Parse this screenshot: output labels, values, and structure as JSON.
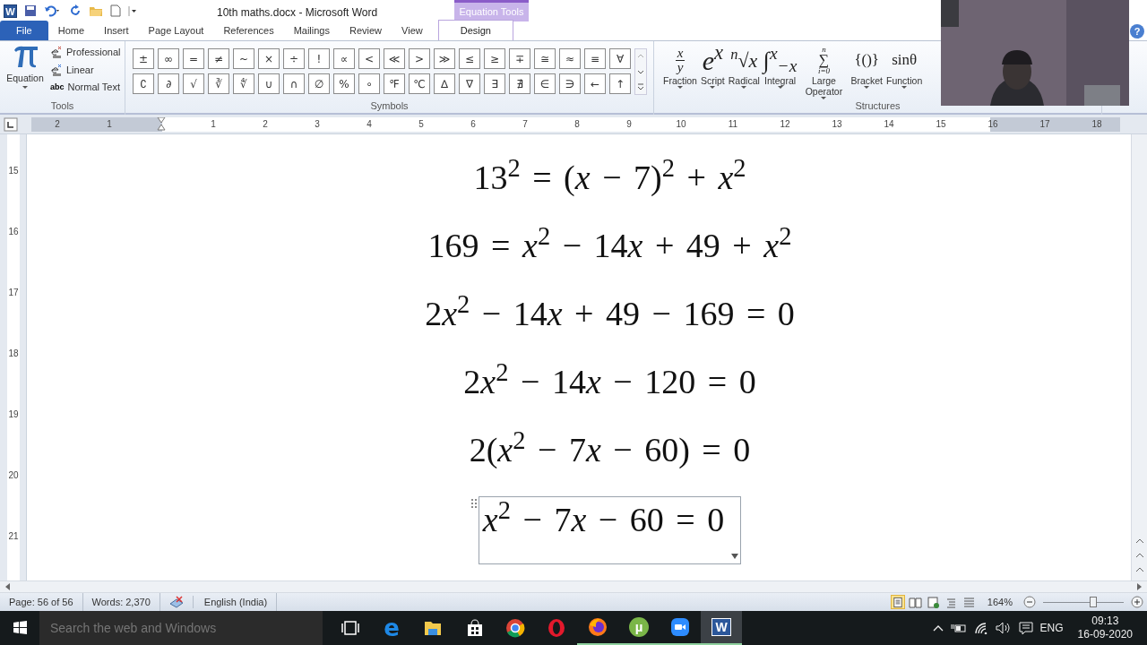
{
  "title_bar": {
    "app_icon_text": "W",
    "title": "10th maths.docx  -  Microsoft Word",
    "contextual_group": "Equation Tools",
    "help_text": "?"
  },
  "tabs": [
    {
      "label": "File",
      "kind": "file",
      "selected": false
    },
    {
      "label": "Home",
      "kind": "tab",
      "selected": false
    },
    {
      "label": "Insert",
      "kind": "tab",
      "selected": false
    },
    {
      "label": "Page Layout",
      "kind": "tab",
      "selected": false
    },
    {
      "label": "References",
      "kind": "tab",
      "selected": false
    },
    {
      "label": "Mailings",
      "kind": "tab",
      "selected": false
    },
    {
      "label": "Review",
      "kind": "tab",
      "selected": false
    },
    {
      "label": "View",
      "kind": "tab",
      "selected": false
    },
    {
      "label": "Design",
      "kind": "contextual",
      "selected": true
    }
  ],
  "ribbon": {
    "tools": {
      "label": "Tools",
      "equation": "Equation",
      "options": [
        {
          "label": "Professional",
          "kind": "professional"
        },
        {
          "label": "Linear",
          "kind": "linear"
        },
        {
          "label": "Normal Text",
          "kind": "normal",
          "icon_text": "abc"
        }
      ]
    },
    "symbols": {
      "label": "Symbols",
      "rows": [
        [
          "±",
          "∞",
          "=",
          "≠",
          "~",
          "×",
          "÷",
          "!",
          "∝",
          "<",
          "≪",
          ">",
          "≫",
          "≤",
          "≥",
          "∓",
          "≅",
          "≈",
          "≡",
          "∀"
        ],
        [
          "∁",
          "∂",
          "√",
          "∛",
          "∜",
          "∪",
          "∩",
          "∅",
          "%",
          "∘",
          "℉",
          "℃",
          "∆",
          "∇",
          "∃",
          "∄",
          "∈",
          "∋",
          "←",
          "↑"
        ]
      ]
    },
    "structures": {
      "label": "Structures",
      "items": [
        {
          "label": "Fraction",
          "kind": "fraction",
          "parts": [
            "x",
            "y"
          ]
        },
        {
          "label": "Script",
          "kind": "script",
          "parts": [
            "e",
            "x"
          ]
        },
        {
          "label": "Radical",
          "kind": "radical",
          "parts": [
            "n",
            "√",
            "x"
          ]
        },
        {
          "label": "Integral",
          "kind": "integral",
          "parts": [
            "∫",
            "x",
            "−x"
          ]
        },
        {
          "label": "Large Operator",
          "kind": "operator",
          "parts": [
            "n",
            "∑",
            "i=0"
          ]
        },
        {
          "label": "Bracket",
          "kind": "plain",
          "parts": [
            "{()}"
          ]
        },
        {
          "label": "Function",
          "kind": "plain",
          "parts": [
            "sinθ"
          ]
        }
      ]
    }
  },
  "ruler": {
    "left_numbers": [
      "2",
      "1"
    ],
    "numbers": [
      "1",
      "2",
      "3",
      "4",
      "5",
      "6",
      "7",
      "8",
      "9",
      "10",
      "11",
      "12",
      "13",
      "14",
      "15",
      "16",
      "17",
      "18"
    ]
  },
  "vertical_ruler": {
    "numbers": [
      "15",
      "16",
      "17",
      "18",
      "19",
      "20",
      "21"
    ]
  },
  "document": {
    "equations": [
      {
        "text": "13$^{2}$ = (x − 7)$^{2}$ + x$^{2}$",
        "selected": false
      },
      {
        "text": "169 = x$^{2}$ − 14x + 49 + x$^{2}$",
        "selected": false
      },
      {
        "text": "2x$^{2}$ − 14x + 49 − 169 = 0",
        "selected": false
      },
      {
        "text": "2x$^{2}$ − 14x − 120 = 0",
        "selected": false
      },
      {
        "text": "2(x$^{2}$ − 7x − 60) = 0",
        "selected": false
      },
      {
        "text": "x$^{2}$ − 7x − 60 = 0",
        "selected": true
      }
    ]
  },
  "status_bar": {
    "page": "Page: 56 of 56",
    "words": "Words: 2,370",
    "language": "English (India)",
    "views": [
      {
        "kind": "print",
        "selected": true
      },
      {
        "kind": "reading",
        "selected": false
      },
      {
        "kind": "web",
        "selected": false
      },
      {
        "kind": "outline",
        "selected": false
      },
      {
        "kind": "draft",
        "selected": false
      }
    ],
    "zoom": "164%",
    "zoom_slider": {
      "level": 0.62
    }
  },
  "taskbar": {
    "search_placeholder": "Search the web and Windows",
    "apps": [
      {
        "kind": "taskview",
        "running": false,
        "active": false
      },
      {
        "kind": "edge",
        "icon_text": "e",
        "running": false,
        "active": false
      },
      {
        "kind": "explorer",
        "running": false,
        "active": false
      },
      {
        "kind": "store",
        "running": false,
        "active": false
      },
      {
        "kind": "chrome",
        "running": false,
        "active": false
      },
      {
        "kind": "opera",
        "running": false,
        "active": false
      },
      {
        "kind": "firefox",
        "running": true,
        "active": false
      },
      {
        "kind": "utorrent",
        "icon_text": "µ",
        "running": true,
        "active": false
      },
      {
        "kind": "zoom",
        "running": true,
        "active": false
      },
      {
        "kind": "word",
        "icon_text": "W",
        "running": true,
        "active": true
      }
    ],
    "language": "ENG",
    "time": "09:13",
    "date": "16-09-2020"
  }
}
